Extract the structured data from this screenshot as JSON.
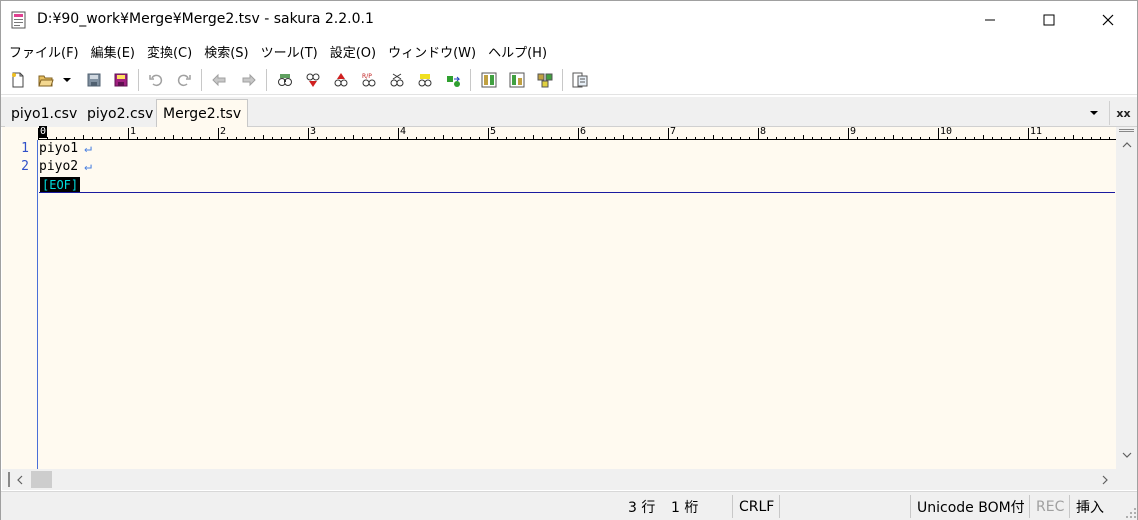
{
  "window": {
    "title": "D:¥90_work¥Merge¥Merge2.tsv - sakura 2.2.0.1"
  },
  "menu": [
    {
      "label": "ファイル(F)"
    },
    {
      "label": "編集(E)"
    },
    {
      "label": "変換(C)"
    },
    {
      "label": "検索(S)"
    },
    {
      "label": "ツール(T)"
    },
    {
      "label": "設定(O)"
    },
    {
      "label": "ウィンドウ(W)"
    },
    {
      "label": "ヘルプ(H)"
    }
  ],
  "toolbar": {
    "icons": [
      "new-file-icon",
      "open-file-icon",
      "dropdown-arrow-icon",
      "save-icon",
      "save-all-icon",
      "undo-icon",
      "redo-icon",
      "jump-back-icon",
      "jump-forward-icon",
      "search-icon",
      "search-next-icon",
      "search-prev-icon",
      "replace-icon",
      "grep-icon",
      "mark-icon",
      "bookmark-jump-icon",
      "tag-jump-icon",
      "compare-icon",
      "outline-icon",
      "function-list-icon",
      "settings-icon"
    ]
  },
  "tabs": [
    {
      "label": "piyo1.csv",
      "active": false
    },
    {
      "label": "piyo2.csv",
      "active": false
    },
    {
      "label": "Merge2.tsv",
      "active": true
    }
  ],
  "tab_controls": {
    "close_all_label": "xx"
  },
  "ruler": {
    "labels": [
      "0",
      "1",
      "2",
      "3",
      "4",
      "5",
      "6",
      "7",
      "8",
      "9",
      "10",
      "11"
    ]
  },
  "editor": {
    "lines": [
      {
        "number": "1",
        "text": "piyo1",
        "eol": "↵"
      },
      {
        "number": "2",
        "text": "piyo2",
        "eol": "↵"
      }
    ],
    "eof_marker": "[EOF]",
    "background": "#fffaf0"
  },
  "status": {
    "row": "3 行",
    "col": "1 桁",
    "line_ending": "CRLF",
    "encoding": "Unicode BOM付",
    "rec": "REC",
    "insert_mode": "挿入"
  }
}
